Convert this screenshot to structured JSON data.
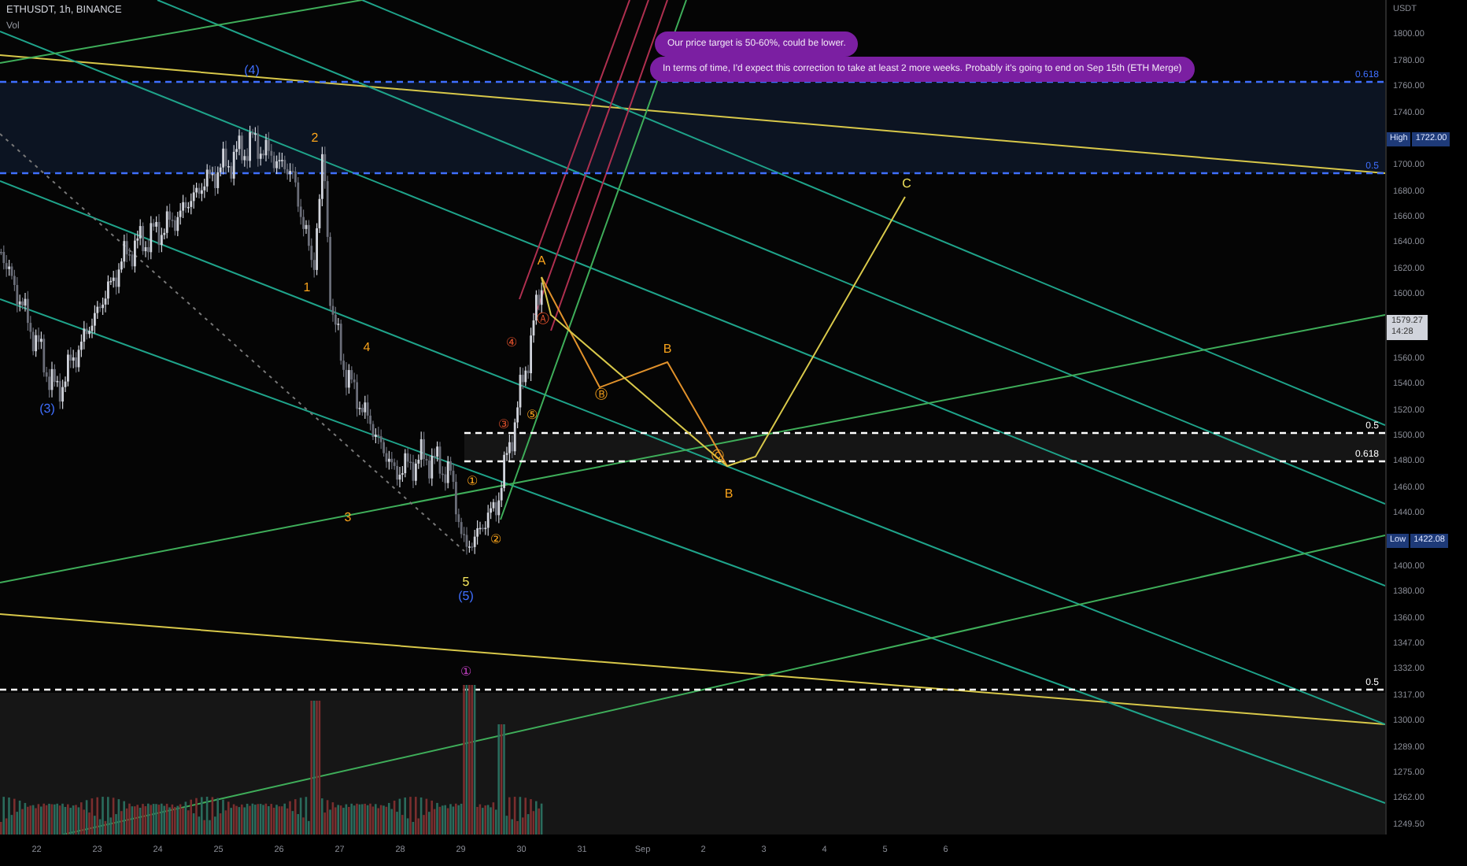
{
  "header": {
    "symbol": "ETHUSDT, 1h, BINANCE",
    "indicator": "Vol"
  },
  "notes": [
    {
      "text": "Our price target is 50-60%, could be lower."
    },
    {
      "text": "In terms of time, I'd expect this correction to take at least 2 more weeks. Probably it's going to end on Sep 15th (ETH Merge)"
    }
  ],
  "fib_levels": [
    {
      "label": "0.618",
      "color": "#3f6fff"
    },
    {
      "label": "0.5",
      "color": "#3f6fff"
    },
    {
      "label": "0.5",
      "color": "#ffffff"
    },
    {
      "label": "0.618",
      "color": "#ffffff"
    },
    {
      "label": "0.5",
      "color": "#ffffff"
    }
  ],
  "wave_labels": [
    {
      "text": "(3)",
      "color": "#3f6fff"
    },
    {
      "text": "(4)",
      "color": "#3f6fff"
    },
    {
      "text": "2",
      "color": "#f7a21b"
    },
    {
      "text": "1",
      "color": "#f7a21b"
    },
    {
      "text": "4",
      "color": "#f7a21b"
    },
    {
      "text": "3",
      "color": "#f7a21b"
    },
    {
      "text": "5",
      "color": "#f2e35c"
    },
    {
      "text": "(5)",
      "color": "#3f6fff"
    },
    {
      "text": "①",
      "color": "#c040c0"
    },
    {
      "text": "①",
      "color": "#f7a21b"
    },
    {
      "text": "②",
      "color": "#f7a21b"
    },
    {
      "text": "③",
      "color": "#e0502b"
    },
    {
      "text": "④",
      "color": "#e0502b"
    },
    {
      "text": "⑤",
      "color": "#f7a21b"
    },
    {
      "text": "A",
      "color": "#f7a21b"
    },
    {
      "text": "Ⓐ",
      "color": "#e0502b"
    },
    {
      "text": "Ⓑ",
      "color": "#f7a21b"
    },
    {
      "text": "B",
      "color": "#f7a21b"
    },
    {
      "text": "Ⓒ",
      "color": "#f7a21b"
    },
    {
      "text": "B",
      "color": "#f7a21b"
    },
    {
      "text": "C",
      "color": "#f2e35c"
    }
  ],
  "price_axis": [
    {
      "kind": "tick",
      "value": "USDT"
    },
    {
      "kind": "tick",
      "value": "1800.00"
    },
    {
      "kind": "tick",
      "value": "1780.00"
    },
    {
      "kind": "tick",
      "value": "1760.00"
    },
    {
      "kind": "tick",
      "value": "1740.00"
    },
    {
      "kind": "high",
      "label": "High",
      "value": "1722.00"
    },
    {
      "kind": "tick",
      "value": "1700.00"
    },
    {
      "kind": "tick",
      "value": "1680.00"
    },
    {
      "kind": "tick",
      "value": "1660.00"
    },
    {
      "kind": "tick",
      "value": "1640.00"
    },
    {
      "kind": "tick",
      "value": "1620.00"
    },
    {
      "kind": "tick",
      "value": "1600.00"
    },
    {
      "kind": "last",
      "value": "1579.27",
      "label": "14:28"
    },
    {
      "kind": "tick",
      "value": "1560.00"
    },
    {
      "kind": "tick",
      "value": "1540.00"
    },
    {
      "kind": "tick",
      "value": "1520.00"
    },
    {
      "kind": "tick",
      "value": "1500.00"
    },
    {
      "kind": "tick",
      "value": "1480.00"
    },
    {
      "kind": "tick",
      "value": "1460.00"
    },
    {
      "kind": "tick",
      "value": "1440.00"
    },
    {
      "kind": "low",
      "label": "Low",
      "value": "1422.08"
    },
    {
      "kind": "tick",
      "value": "1400.00"
    },
    {
      "kind": "tick",
      "value": "1380.00"
    },
    {
      "kind": "tick",
      "value": "1360.00"
    },
    {
      "kind": "tick",
      "value": "1347.00"
    },
    {
      "kind": "tick",
      "value": "1332.00"
    },
    {
      "kind": "tick",
      "value": "1317.00"
    },
    {
      "kind": "tick",
      "value": "1300.00"
    },
    {
      "kind": "tick",
      "value": "1289.00"
    },
    {
      "kind": "tick",
      "value": "1275.00"
    },
    {
      "kind": "tick",
      "value": "1262.00"
    },
    {
      "kind": "tick",
      "value": "1249.50"
    }
  ],
  "time_axis": [
    "22",
    "23",
    "24",
    "25",
    "26",
    "27",
    "28",
    "29",
    "30",
    "31",
    "Sep",
    "2",
    "3",
    "4",
    "5",
    "6"
  ]
}
